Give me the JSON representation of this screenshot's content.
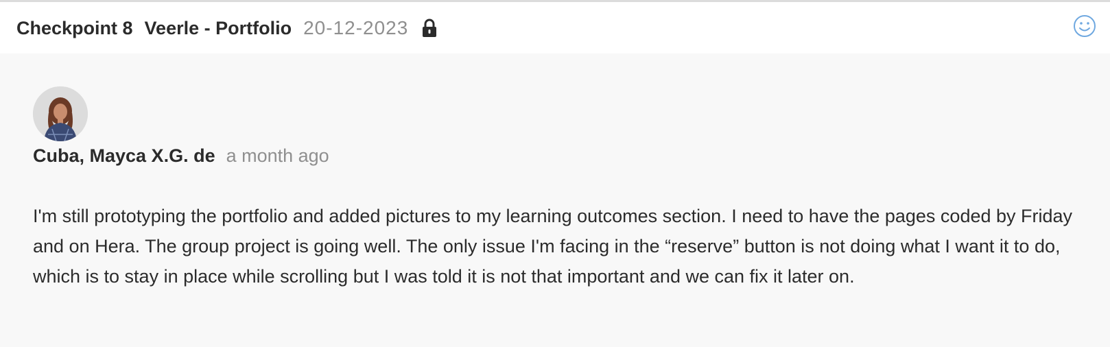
{
  "header": {
    "checkpoint": "Checkpoint 8",
    "project": "Veerle - Portfolio",
    "date": "20-12-2023",
    "lock_icon": "lock-icon",
    "reaction_icon": "smiley-icon"
  },
  "comment": {
    "author": "Cuba, Mayca X.G. de",
    "timestamp": "a month ago",
    "body": "I'm still prototyping the portfolio and added pictures to my learning outcomes section. I need to have the pages coded by Friday and on Hera. The group project is going well. The only issue I'm facing in the “reserve” button is not doing what I want it to do, which is to stay in place while scrolling but I was told it is not that important and we can fix it later on."
  },
  "colors": {
    "accent": "#6fa8e0",
    "muted_text": "#8f8f8f",
    "primary_text": "#2b2b2b",
    "background": "#f8f8f8"
  }
}
